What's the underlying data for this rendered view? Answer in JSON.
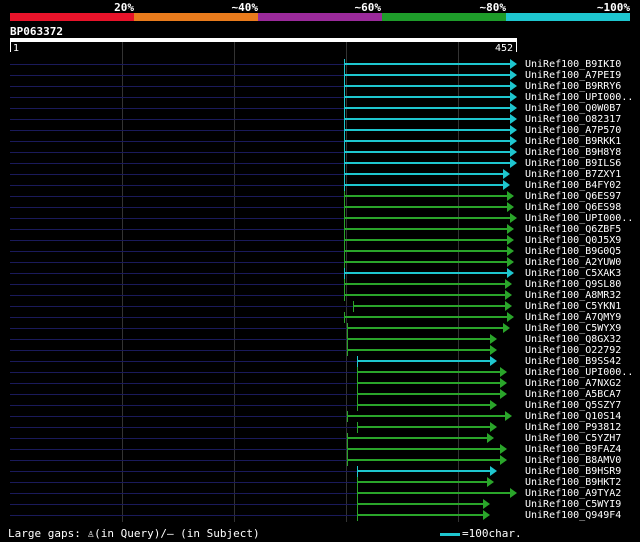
{
  "header": {
    "percent_labels": [
      "20%",
      "~40%",
      "~60%",
      "~80%",
      "~100%"
    ],
    "band_colors": [
      "#e8132a",
      "#e97b1c",
      "#9b2a9b",
      "#1e9c2a",
      "#1ec6cf"
    ]
  },
  "query": {
    "title": "BP063372",
    "start": "1",
    "end": "452"
  },
  "colors": {
    "cyan": "#1ec6cf",
    "green": "#2aa52a",
    "dark": "#1a1a5a"
  },
  "hits": [
    {
      "label": "UniRef100_B9IKI0",
      "start": 344,
      "end": 510,
      "color": "cyan"
    },
    {
      "label": "UniRef100_A7PEI9",
      "start": 344,
      "end": 510,
      "color": "cyan"
    },
    {
      "label": "UniRef100_B9RRY6",
      "start": 344,
      "end": 510,
      "color": "cyan"
    },
    {
      "label": "UniRef100_UPI000..",
      "start": 344,
      "end": 510,
      "color": "cyan"
    },
    {
      "label": "UniRef100_Q0W0B7",
      "start": 344,
      "end": 510,
      "color": "cyan"
    },
    {
      "label": "UniRef100_O82317",
      "start": 344,
      "end": 510,
      "color": "cyan"
    },
    {
      "label": "UniRef100_A7P570",
      "start": 344,
      "end": 510,
      "color": "cyan"
    },
    {
      "label": "UniRef100_B9RKK1",
      "start": 344,
      "end": 510,
      "color": "cyan"
    },
    {
      "label": "UniRef100_B9H8Y8",
      "start": 344,
      "end": 510,
      "color": "cyan"
    },
    {
      "label": "UniRef100_B9ILS6",
      "start": 344,
      "end": 510,
      "color": "cyan"
    },
    {
      "label": "UniRef100_B7ZXY1",
      "start": 344,
      "end": 503,
      "color": "cyan"
    },
    {
      "label": "UniRef100_B4FY02",
      "start": 344,
      "end": 503,
      "color": "cyan"
    },
    {
      "label": "UniRef100_Q6ES97",
      "start": 344,
      "end": 507,
      "color": "green"
    },
    {
      "label": "UniRef100_Q6ES98",
      "start": 344,
      "end": 507,
      "color": "green"
    },
    {
      "label": "UniRef100_UPI000..",
      "start": 344,
      "end": 510,
      "color": "green"
    },
    {
      "label": "UniRef100_Q6ZBF5",
      "start": 344,
      "end": 507,
      "color": "green"
    },
    {
      "label": "UniRef100_Q0J5X9",
      "start": 344,
      "end": 507,
      "color": "green"
    },
    {
      "label": "UniRef100_B9G0Q5",
      "start": 344,
      "end": 507,
      "color": "green"
    },
    {
      "label": "UniRef100_A2YUW0",
      "start": 344,
      "end": 507,
      "color": "green"
    },
    {
      "label": "UniRef100_C5XAK3",
      "start": 344,
      "end": 507,
      "color": "cyan"
    },
    {
      "label": "UniRef100_Q9SL80",
      "start": 344,
      "end": 505,
      "color": "green"
    },
    {
      "label": "UniRef100_A8MR32",
      "start": 344,
      "end": 505,
      "color": "green"
    },
    {
      "label": "UniRef100_C5YKN1",
      "start": 353,
      "end": 505,
      "color": "green"
    },
    {
      "label": "UniRef100_A7QMY9",
      "start": 344,
      "end": 507,
      "color": "green"
    },
    {
      "label": "UniRef100_C5WYX9",
      "start": 347,
      "end": 503,
      "color": "green"
    },
    {
      "label": "UniRef100_Q8GX32",
      "start": 347,
      "end": 490,
      "color": "green"
    },
    {
      "label": "UniRef100_O22792",
      "start": 347,
      "end": 490,
      "color": "green"
    },
    {
      "label": "UniRef100_B9SS42",
      "start": 357,
      "end": 490,
      "color": "cyan"
    },
    {
      "label": "UniRef100_UPI000..",
      "start": 357,
      "end": 500,
      "color": "green"
    },
    {
      "label": "UniRef100_A7NXG2",
      "start": 357,
      "end": 500,
      "color": "green"
    },
    {
      "label": "UniRef100_A5BCA7",
      "start": 357,
      "end": 500,
      "color": "green"
    },
    {
      "label": "UniRef100_Q5SZY7",
      "start": 357,
      "end": 490,
      "color": "green"
    },
    {
      "label": "UniRef100_Q10S14",
      "start": 347,
      "end": 505,
      "color": "green"
    },
    {
      "label": "UniRef100_P93812",
      "start": 357,
      "end": 490,
      "color": "green"
    },
    {
      "label": "UniRef100_C5YZH7",
      "start": 347,
      "end": 487,
      "color": "green"
    },
    {
      "label": "UniRef100_B9FAZ4",
      "start": 347,
      "end": 500,
      "color": "green"
    },
    {
      "label": "UniRef100_B8AMV0",
      "start": 347,
      "end": 500,
      "color": "green"
    },
    {
      "label": "UniRef100_B9HSR9",
      "start": 357,
      "end": 490,
      "color": "cyan"
    },
    {
      "label": "UniRef100_B9HKT2",
      "start": 357,
      "end": 487,
      "color": "green"
    },
    {
      "label": "UniRef100_A9TYA2",
      "start": 357,
      "end": 510,
      "color": "green"
    },
    {
      "label": "UniRef100_C5WYI9",
      "start": 357,
      "end": 483,
      "color": "green"
    },
    {
      "label": "UniRef100_Q949F4",
      "start": 357,
      "end": 483,
      "color": "green"
    }
  ],
  "footer": {
    "text": "Large gaps: ♙(in Query)/– (in Subject)",
    "scale_label": "=100char."
  }
}
